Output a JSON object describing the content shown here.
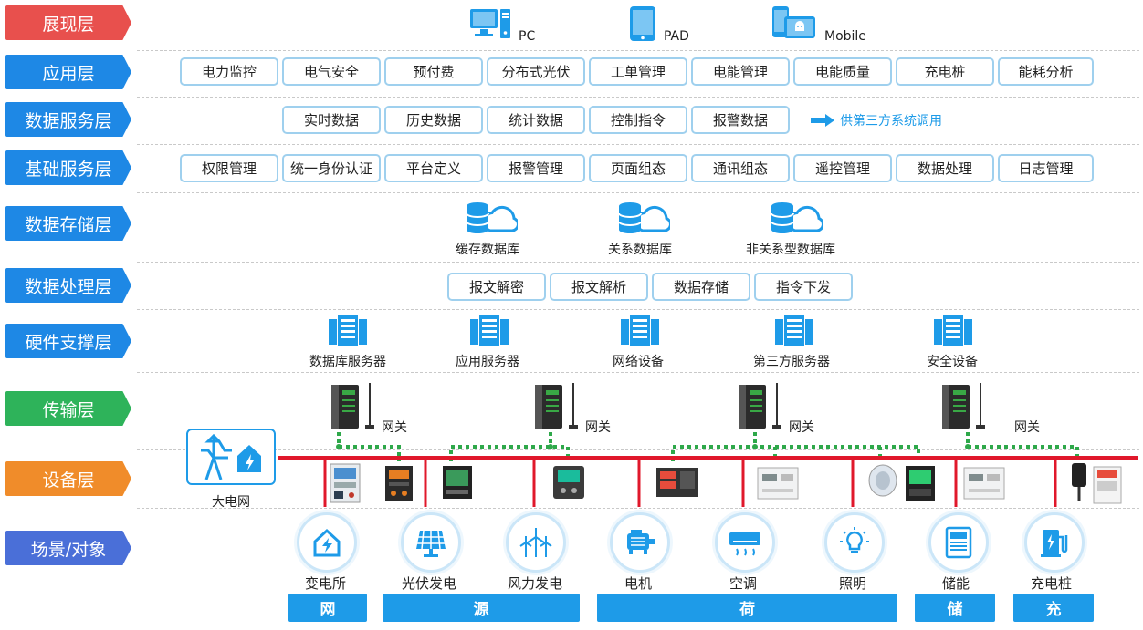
{
  "layers": [
    {
      "label": "展现层",
      "color": "#e8504d"
    },
    {
      "label": "应用层",
      "color": "#1e88e5"
    },
    {
      "label": "数据服务层",
      "color": "#1e88e5"
    },
    {
      "label": "基础服务层",
      "color": "#1e88e5"
    },
    {
      "label": "数据存储层",
      "color": "#1e88e5"
    },
    {
      "label": "数据处理层",
      "color": "#1e88e5"
    },
    {
      "label": "硬件支撑层",
      "color": "#1e88e5"
    },
    {
      "label": "传输层",
      "color": "#2eb35a"
    },
    {
      "label": "设备层",
      "color": "#f08c2a"
    },
    {
      "label": "场景/对象",
      "color": "#4a6fd8"
    }
  ],
  "presentation": {
    "pc": "PC",
    "pad": "PAD",
    "mobile": "Mobile"
  },
  "applications": [
    "电力监控",
    "电气安全",
    "预付费",
    "分布式光伏",
    "工单管理",
    "电能管理",
    "电能质量",
    "充电桩",
    "能耗分析"
  ],
  "data_services": [
    "实时数据",
    "历史数据",
    "统计数据",
    "控制指令",
    "报警数据"
  ],
  "third_party_note": "供第三方系统调用",
  "base_services": [
    "权限管理",
    "统一身份认证",
    "平台定义",
    "报警管理",
    "页面组态",
    "通讯组态",
    "遥控管理",
    "数据处理",
    "日志管理"
  ],
  "storage": [
    "缓存数据库",
    "关系数据库",
    "非关系型数据库"
  ],
  "processing": [
    "报文解密",
    "报文解析",
    "数据存储",
    "指令下发"
  ],
  "hardware": [
    "数据库服务器",
    "应用服务器",
    "网络设备",
    "第三方服务器",
    "安全设备"
  ],
  "gateway_label": "网关",
  "grid_label": "大电网",
  "scenes": [
    "变电所",
    "光伏发电",
    "风力发电",
    "电机",
    "空调",
    "照明",
    "储能",
    "充电桩"
  ],
  "categories": [
    "网",
    "源",
    "荷",
    "储",
    "充"
  ],
  "colors": {
    "accent": "#1e9be8",
    "bus": "#e0182b",
    "dotted": "#2ea84a",
    "box_border": "#9fd0ee"
  }
}
